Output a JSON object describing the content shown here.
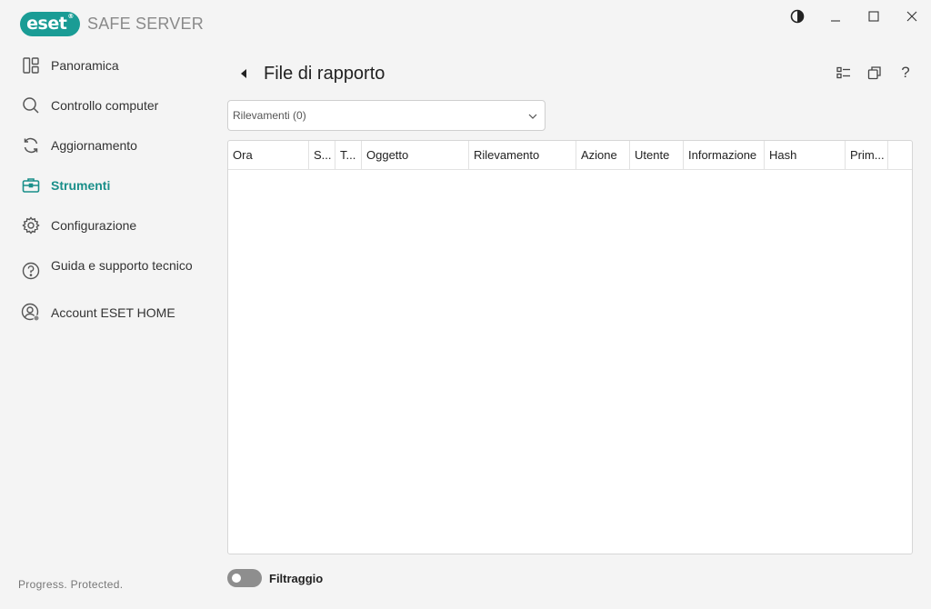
{
  "app": {
    "logo_text": "eset",
    "logo_mark": "®",
    "product_name": "SAFE SERVER"
  },
  "window_controls": {
    "theme": "◐",
    "minimize": "—",
    "maximize": "☐",
    "close": "✕"
  },
  "sidebar": {
    "items": [
      {
        "label": "Panoramica",
        "icon": "overview-icon"
      },
      {
        "label": "Controllo computer",
        "icon": "search-icon"
      },
      {
        "label": "Aggiornamento",
        "icon": "refresh-icon"
      },
      {
        "label": "Strumenti",
        "icon": "toolbox-icon",
        "active": true
      },
      {
        "label": "Configurazione",
        "icon": "gear-icon"
      },
      {
        "label": "Guida e supporto tecnico",
        "icon": "help-icon"
      },
      {
        "label": "Account ESET HOME",
        "icon": "account-icon"
      }
    ],
    "footer": "Progress. Protected."
  },
  "page": {
    "title": "File di rapporto",
    "tools": {
      "help": "?"
    }
  },
  "filter_dropdown": {
    "value": "Rilevamenti (0)"
  },
  "table": {
    "columns": [
      "Ora",
      "S...",
      "T...",
      "Oggetto",
      "Rilevamento",
      "Azione",
      "Utente",
      "Informazione",
      "Hash",
      "Prim..."
    ],
    "rows": []
  },
  "filter_toggle": {
    "label": "Filtraggio",
    "enabled": false
  },
  "colors": {
    "accent": "#1a9c95",
    "background": "#f4f4f4"
  }
}
